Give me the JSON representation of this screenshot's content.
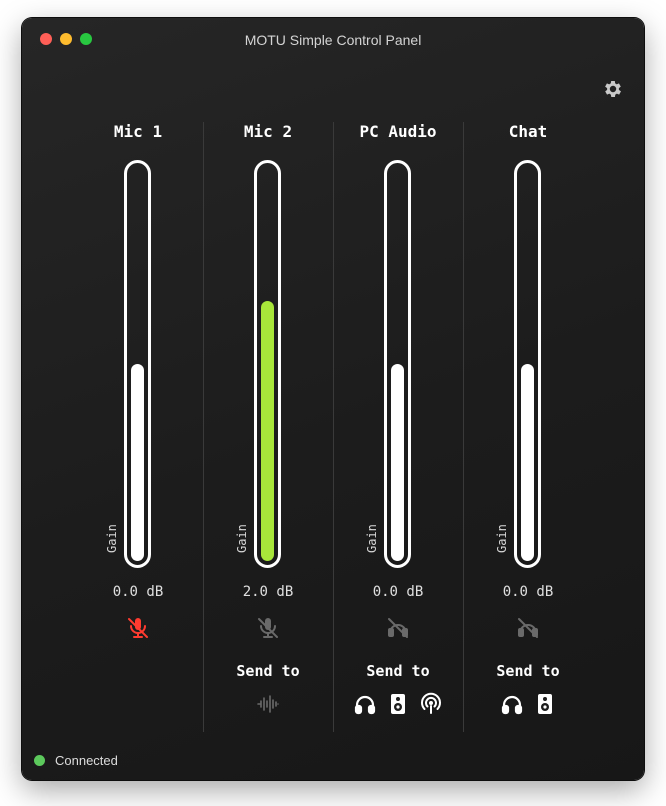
{
  "window": {
    "title": "MOTU Simple Control Panel"
  },
  "colors": {
    "active_meter": "#a8e63a",
    "muted_red": "#ff3b30",
    "inactive_icon": "#6a6a6a",
    "connected": "#5cc95c"
  },
  "channels": [
    {
      "name": "Mic 1",
      "gain_label": "Gain",
      "db": "0.0 dB",
      "level": 0.5,
      "active": false,
      "mute_icon": "mic-muted-icon",
      "muted": true,
      "send_label": "",
      "sends": []
    },
    {
      "name": "Mic 2",
      "gain_label": "Gain",
      "db": "2.0 dB",
      "level": 0.66,
      "active": true,
      "mute_icon": "mic-muted-icon",
      "muted": false,
      "send_label": "Send to",
      "sends": [
        {
          "icon": "waveform-icon",
          "enabled": false
        }
      ]
    },
    {
      "name": "PC Audio",
      "gain_label": "Gain",
      "db": "0.0 dB",
      "level": 0.5,
      "active": false,
      "mute_icon": "speaker-muted-icon",
      "muted": false,
      "send_label": "Send to",
      "sends": [
        {
          "icon": "headphones-icon",
          "enabled": true
        },
        {
          "icon": "speaker-icon",
          "enabled": true
        },
        {
          "icon": "podcast-icon",
          "enabled": true
        }
      ]
    },
    {
      "name": "Chat",
      "gain_label": "Gain",
      "db": "0.0 dB",
      "level": 0.5,
      "active": false,
      "mute_icon": "speaker-muted-icon",
      "muted": false,
      "send_label": "Send to",
      "sends": [
        {
          "icon": "headphones-icon",
          "enabled": true
        },
        {
          "icon": "speaker-icon",
          "enabled": true
        }
      ]
    }
  ],
  "status": {
    "text": "Connected",
    "icon": "status-dot"
  }
}
